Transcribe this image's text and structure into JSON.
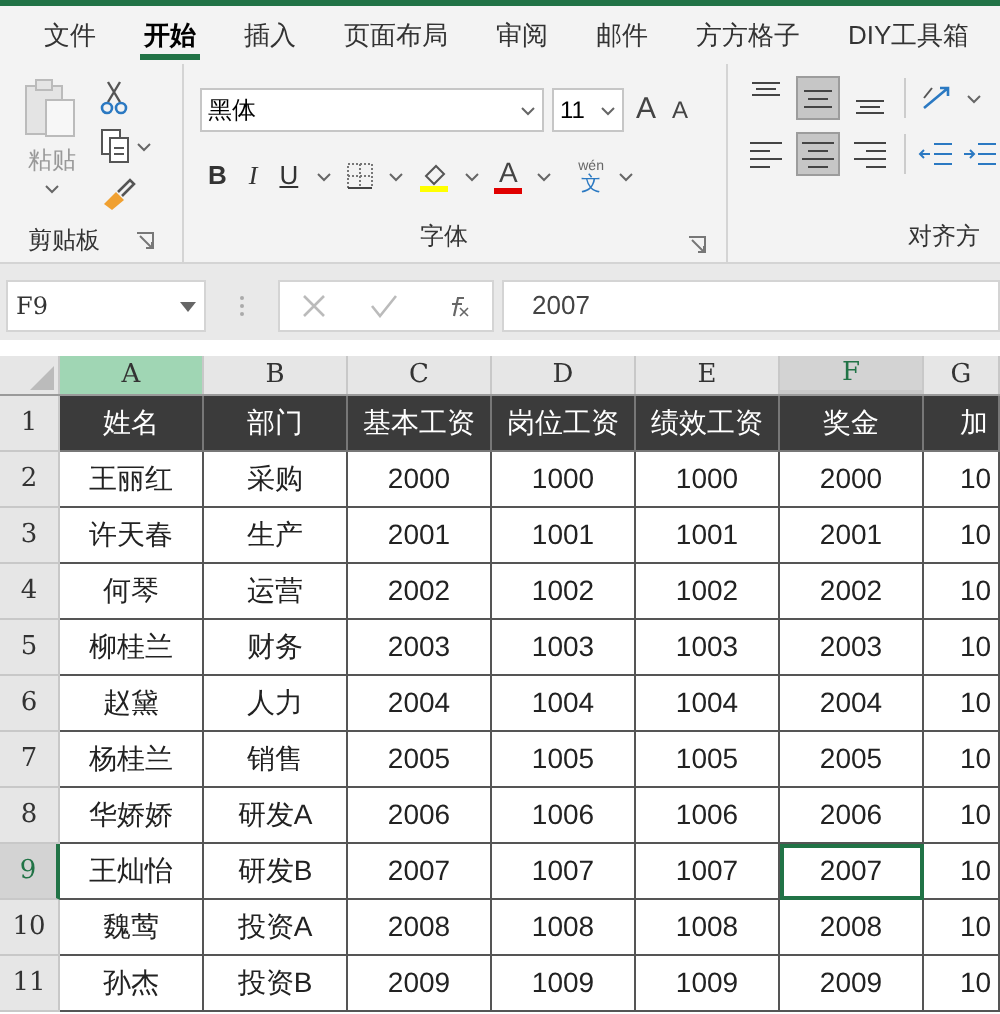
{
  "tabs": [
    {
      "label": "文件",
      "selected": false
    },
    {
      "label": "开始",
      "selected": true
    },
    {
      "label": "插入",
      "selected": false
    },
    {
      "label": "页面布局",
      "selected": false
    },
    {
      "label": "审阅",
      "selected": false
    },
    {
      "label": "邮件",
      "selected": false
    },
    {
      "label": "方方格子",
      "selected": false
    },
    {
      "label": "DIY工具箱",
      "selected": false
    }
  ],
  "ribbon": {
    "clipboard": {
      "paste_label": "粘贴",
      "group_label": "剪贴板"
    },
    "font": {
      "font_name": "黑体",
      "font_size": "11",
      "bold_label": "B",
      "italic_label": "I",
      "underline_label": "U",
      "font_color_label": "A",
      "grow_label": "A",
      "shrink_label": "A",
      "phonetic_top": "wén",
      "phonetic_bottom": "文",
      "group_label": "字体"
    },
    "alignment": {
      "vertical": [
        {
          "selected": false
        },
        {
          "selected": true
        },
        {
          "selected": false
        }
      ],
      "horizontal": [
        {
          "selected": false
        },
        {
          "selected": true
        },
        {
          "selected": false
        }
      ],
      "group_label": "对齐方"
    }
  },
  "formula_bar": {
    "name_box": "F9",
    "formula": "2007"
  },
  "columns": [
    {
      "letter": "A",
      "highlighted": true,
      "selected": false
    },
    {
      "letter": "B",
      "highlighted": false,
      "selected": false
    },
    {
      "letter": "C",
      "highlighted": false,
      "selected": false
    },
    {
      "letter": "D",
      "highlighted": false,
      "selected": false
    },
    {
      "letter": "E",
      "highlighted": false,
      "selected": false
    },
    {
      "letter": "F",
      "highlighted": false,
      "selected": true
    },
    {
      "letter": "G",
      "highlighted": false,
      "selected": false
    }
  ],
  "rows": [
    {
      "number": "1",
      "selected": false,
      "kind": "header",
      "cells": [
        "姓名",
        "部门",
        "基本工资",
        "岗位工资",
        "绩效工资",
        "奖金",
        "加"
      ]
    },
    {
      "number": "2",
      "selected": false,
      "kind": "data",
      "cells": [
        "王丽红",
        "采购",
        "2000",
        "1000",
        "1000",
        "2000",
        "10"
      ]
    },
    {
      "number": "3",
      "selected": false,
      "kind": "data",
      "cells": [
        "许天春",
        "生产",
        "2001",
        "1001",
        "1001",
        "2001",
        "10"
      ]
    },
    {
      "number": "4",
      "selected": false,
      "kind": "data",
      "cells": [
        "何琴",
        "运营",
        "2002",
        "1002",
        "1002",
        "2002",
        "10"
      ]
    },
    {
      "number": "5",
      "selected": false,
      "kind": "data",
      "cells": [
        "柳桂兰",
        "财务",
        "2003",
        "1003",
        "1003",
        "2003",
        "10"
      ]
    },
    {
      "number": "6",
      "selected": false,
      "kind": "data",
      "cells": [
        "赵黛",
        "人力",
        "2004",
        "1004",
        "1004",
        "2004",
        "10"
      ]
    },
    {
      "number": "7",
      "selected": false,
      "kind": "data",
      "cells": [
        "杨桂兰",
        "销售",
        "2005",
        "1005",
        "1005",
        "2005",
        "10"
      ]
    },
    {
      "number": "8",
      "selected": false,
      "kind": "data",
      "cells": [
        "华娇娇",
        "研发A",
        "2006",
        "1006",
        "1006",
        "2006",
        "10"
      ]
    },
    {
      "number": "9",
      "selected": true,
      "kind": "data",
      "cells": [
        "王灿怡",
        "研发B",
        "2007",
        "1007",
        "1007",
        "2007",
        "10"
      ]
    },
    {
      "number": "10",
      "selected": false,
      "kind": "data",
      "cells": [
        "魏莺",
        "投资A",
        "2008",
        "1008",
        "1008",
        "2008",
        "10"
      ]
    },
    {
      "number": "11",
      "selected": false,
      "kind": "data",
      "cells": [
        "孙杰",
        "投资B",
        "2009",
        "1009",
        "1009",
        "2009",
        "10"
      ]
    }
  ]
}
